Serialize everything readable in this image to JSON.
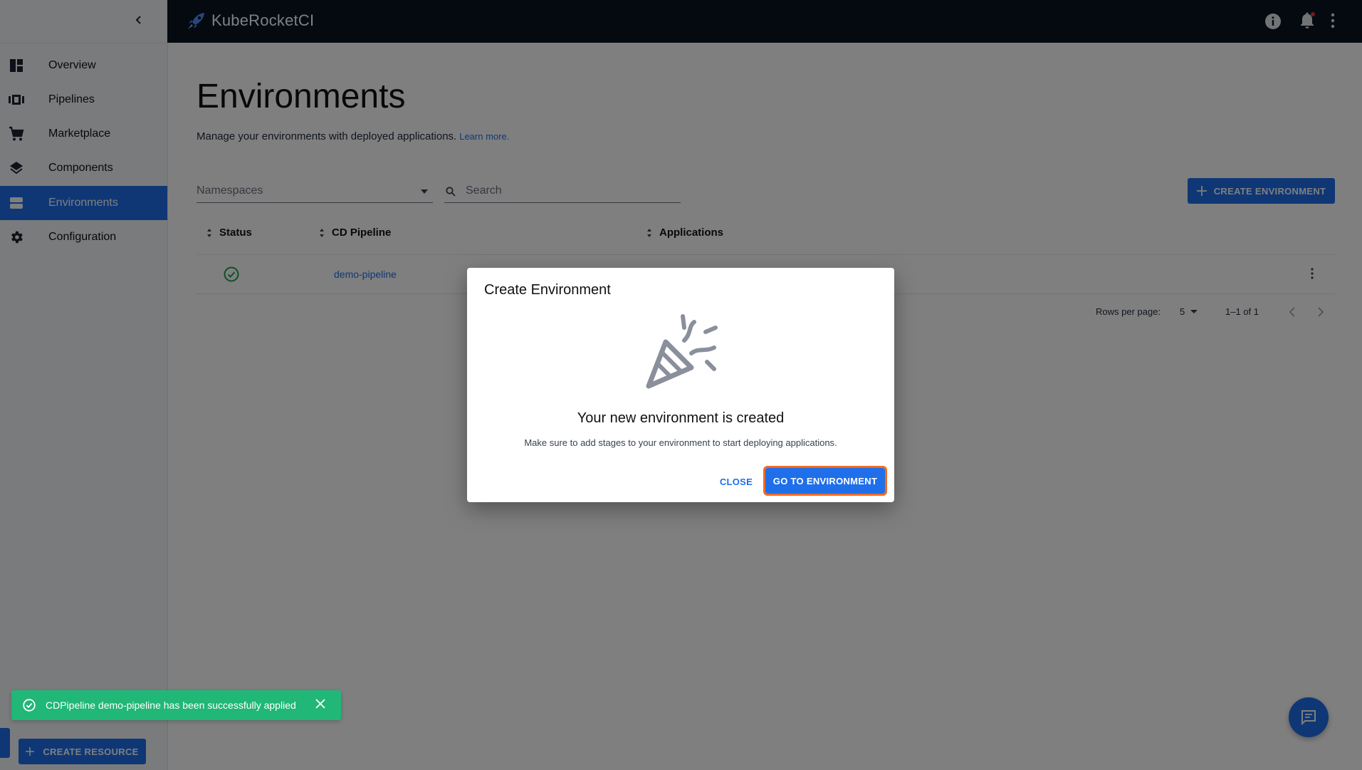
{
  "app": {
    "name": "KubeRocketCI"
  },
  "sidebar": {
    "items": [
      {
        "label": "Overview",
        "icon": "dashboard-icon"
      },
      {
        "label": "Pipelines",
        "icon": "pipelines-icon"
      },
      {
        "label": "Marketplace",
        "icon": "cart-icon"
      },
      {
        "label": "Components",
        "icon": "layers-icon"
      },
      {
        "label": "Environments",
        "icon": "environments-icon",
        "active": true
      },
      {
        "label": "Configuration",
        "icon": "gear-icon"
      }
    ],
    "create_resource_label": "CREATE RESOURCE"
  },
  "page": {
    "title": "Environments",
    "description": "Manage your environments with deployed applications.",
    "learn_more": "Learn more."
  },
  "filters": {
    "namespaces_placeholder": "Namespaces",
    "search_placeholder": "Search",
    "create_button": "CREATE ENVIRONMENT"
  },
  "table": {
    "columns": [
      "Status",
      "CD Pipeline",
      "Applications"
    ],
    "rows": [
      {
        "status": "success",
        "cd_pipeline": "demo-pipeline",
        "applications": ""
      }
    ],
    "pagination": {
      "rows_per_page_label": "Rows per page:",
      "rows_per_page": "5",
      "range": "1–1 of 1"
    }
  },
  "dialog": {
    "title": "Create Environment",
    "heading": "Your new environment is created",
    "text": "Make sure to add stages to your environment to start deploying applications.",
    "close_label": "CLOSE",
    "go_label": "GO TO ENVIRONMENT"
  },
  "toast": {
    "message": "CDPipeline demo-pipeline has been successfully applied"
  },
  "colors": {
    "accent": "#1f6feb",
    "topbar": "#0b1423",
    "success": "#20b777",
    "highlight": "#f26b21"
  }
}
